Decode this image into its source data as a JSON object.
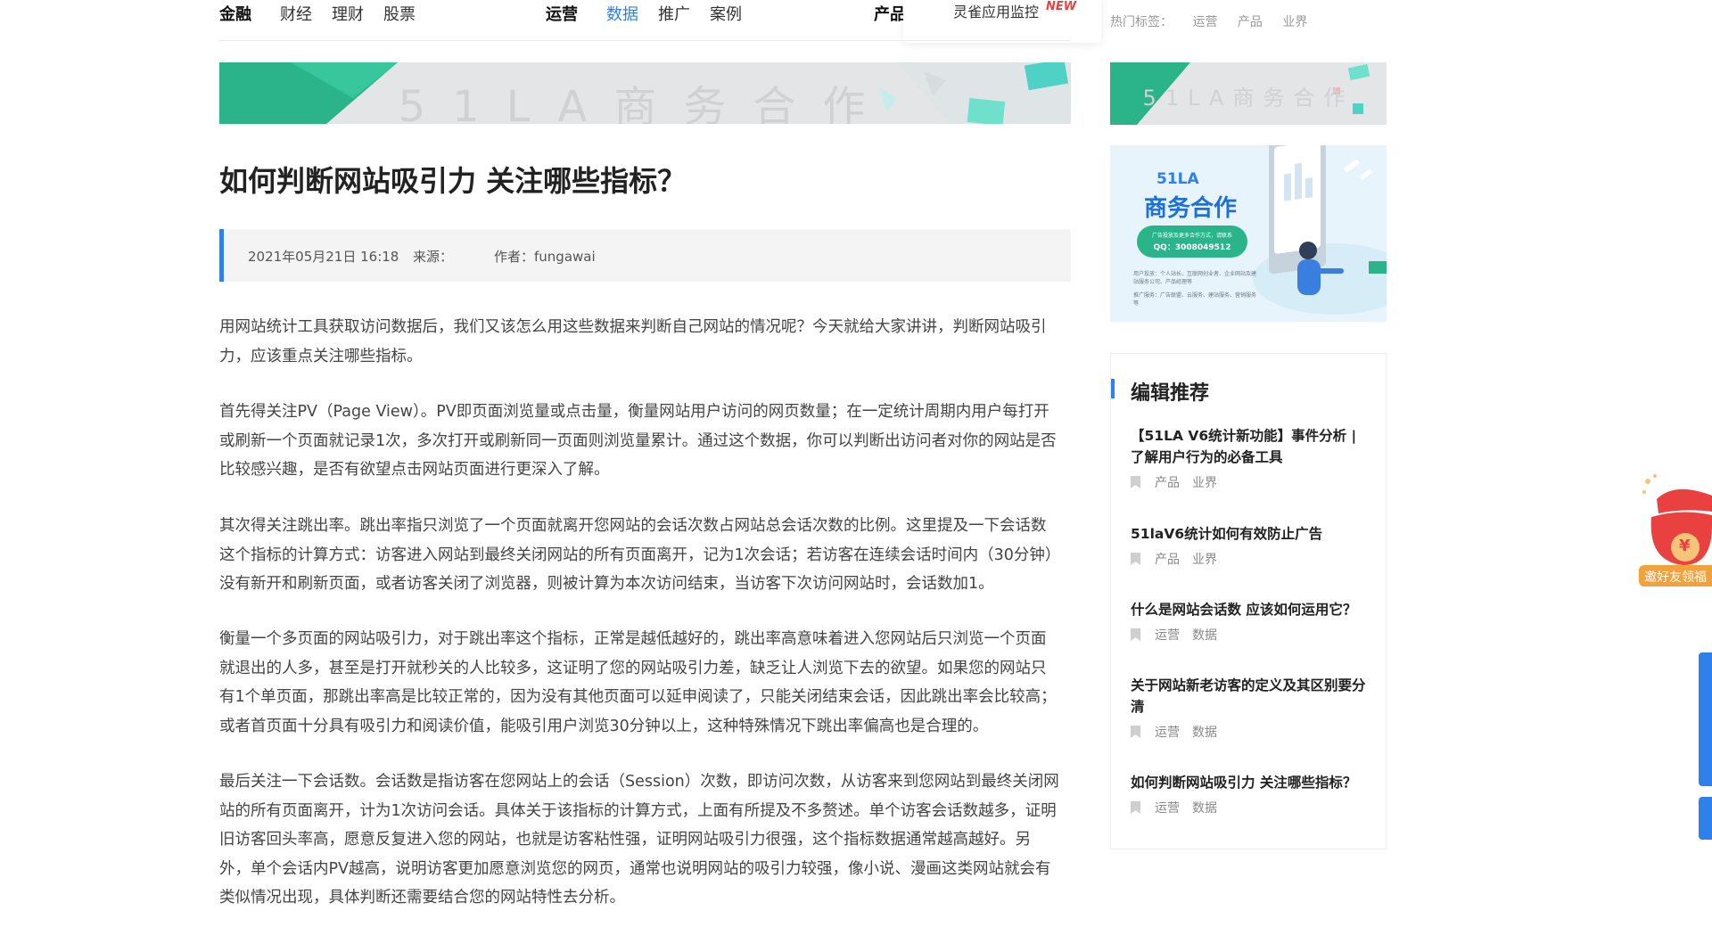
{
  "nav": {
    "groups": [
      {
        "head": "金融",
        "items": [
          "财经",
          "理财",
          "股票"
        ]
      },
      {
        "head": "运营",
        "items": [
          "数据",
          "推广",
          "案例"
        ]
      },
      {
        "head": "产品",
        "items": []
      }
    ],
    "active_item": "数据",
    "dropdown": {
      "label": "灵雀应用监控",
      "badge": "NEW"
    }
  },
  "hot_tags": {
    "label": "热门标签：",
    "tags": [
      "运营",
      "产品",
      "业界"
    ]
  },
  "banner": {
    "text": "51LA商务合作"
  },
  "ad": {
    "brand": "51LA",
    "title": "商务合作",
    "pill_line1": "广告投放及更多合作方式，请联系",
    "pill_line2": "QQ：3008049512",
    "note1": "用户投放：个人站长、互联网创业者、企业网站及建站服务公司、产品经理等",
    "note2": "推广服务：广告联盟、云服务、建站服务、营销服务等"
  },
  "article": {
    "title": "如何判断网站吸引力 关注哪些指标？",
    "date": "2021年05月21日 16:18",
    "source_label": "来源：",
    "author_label": "作者：fungawai",
    "paragraphs": [
      [
        "用网站统计工具获取访问数据后，我们又该怎么用这些数据来判断自己网站的情况呢？今天就给大家讲讲，判断网站吸引",
        "力，应该重点关注哪些指标。"
      ],
      [
        "首先得关注PV（Page View）。PV即页面浏览量或点击量，衡量网站用户访问的网页数量；在一定统计周期内用户每打开",
        "或刷新一个页面就记录1次，多次打开或刷新同一页面则浏览量累计。通过这个数据，你可以判断出访问者对你的网站是否",
        "比较感兴趣，是否有欲望点击网站页面进行更深入了解。"
      ],
      [
        "其次得关注跳出率。跳出率指只浏览了一个页面就离开您网站的会话次数占网站总会话次数的比例。这里提及一下会话数",
        "这个指标的计算方式：访客进入网站到最终关闭网站的所有页面离开，记为1次会话；若访客在连续会话时间内（30分钟）",
        "没有新开和刷新页面，或者访客关闭了浏览器，则被计算为本次访问结束，当访客下次访问网站时，会话数加1。"
      ],
      [
        "衡量一个多页面的网站吸引力，对于跳出率这个指标，正常是越低越好的，跳出率高意味着进入您网站后只浏览一个页面",
        "就退出的人多，甚至是打开就秒关的人比较多，这证明了您的网站吸引力差，缺乏让人浏览下去的欲望。如果您的网站只",
        "有1个单页面，那跳出率高是比较正常的，因为没有其他页面可以延申阅读了，只能关闭结束会话，因此跳出率会比较高；",
        "或者首页面十分具有吸引力和阅读价值，能吸引用户浏览30分钟以上，这种特殊情况下跳出率偏高也是合理的。"
      ],
      [
        "最后关注一下会话数。会话数是指访客在您网站上的会话（Session）次数，即访问次数，从访客来到您网站到最终关闭网",
        "站的所有页面离开，计为1次访问会话。具体关于该指标的计算方式，上面有所提及不多赘述。单个访客会话数越多，证明",
        "旧访客回头率高，愿意反复进入您的网站，也就是访客粘性强，证明网站吸引力很强，这个指标数据通常越高越好。另",
        "外，单个会话内PV越高，说明访客更加愿意浏览您的网页，通常也说明网站的吸引力较强，像小说、漫画这类网站就会有",
        "类似情况出现，具体判断还需要结合您的网站特性去分析。"
      ]
    ]
  },
  "sidebar": {
    "heading": "编辑推荐",
    "items": [
      {
        "title": "【51LA V6统计新功能】事件分析 | 了解用户行为的必备工具",
        "tags": [
          "产品",
          "业界"
        ]
      },
      {
        "title": "51laV6统计如何有效防止广告",
        "tags": [
          "产品",
          "业界"
        ]
      },
      {
        "title": "什么是网站会话数 应该如何运用它？",
        "tags": [
          "运营",
          "数据"
        ]
      },
      {
        "title": "关于网站新老访客的定义及其区别要分清",
        "tags": [
          "运营",
          "数据"
        ]
      },
      {
        "title": "如何判断网站吸引力 关注哪些指标？",
        "tags": [
          "运营",
          "数据"
        ]
      }
    ]
  },
  "float": {
    "invite_label": "邀好友领福",
    "coin": "¥"
  },
  "colors": {
    "accent": "#2f80ed",
    "banner_green": "#2bb48a",
    "badge_red": "#e8413f",
    "float_red": "#e8413f"
  }
}
